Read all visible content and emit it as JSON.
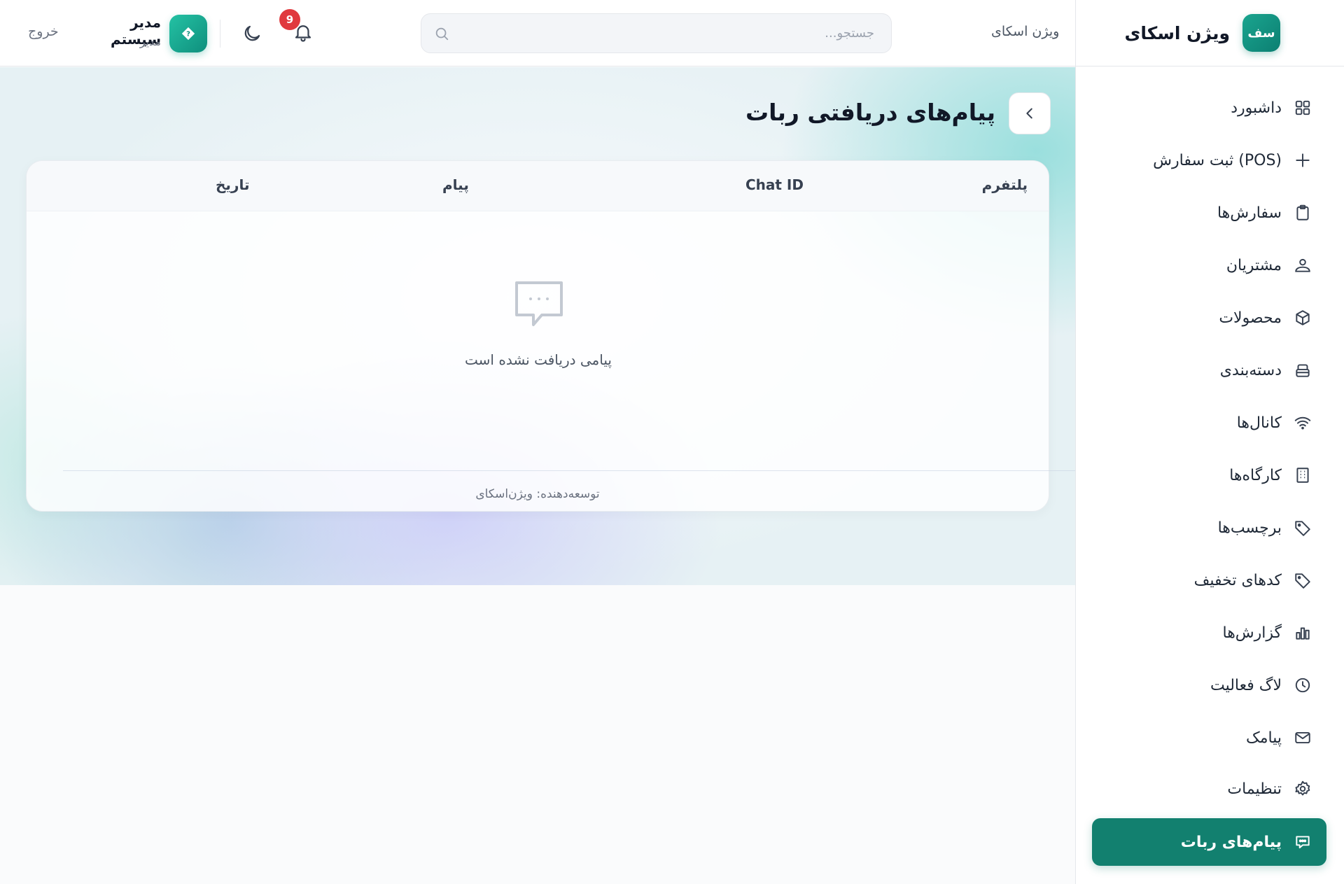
{
  "brand": {
    "logo_text": "سف",
    "name": "ویژن اسکای"
  },
  "header": {
    "brand_text": "ویژن اسکای",
    "search_placeholder": "جستجو...",
    "notifications_count": "9",
    "user_name": "مدیر سیستم",
    "user_role": "مدیر",
    "logout_label": "خروج"
  },
  "sidebar": {
    "items": [
      {
        "label": "داشبورد",
        "icon": "dashboard-icon"
      },
      {
        "label": "ثبت سفارش (POS)",
        "icon": "plus-icon"
      },
      {
        "label": "سفارش‌ها",
        "icon": "clipboard-icon"
      },
      {
        "label": "مشتریان",
        "icon": "customers-icon"
      },
      {
        "label": "محصولات",
        "icon": "box-icon"
      },
      {
        "label": "دسته‌بندی",
        "icon": "category-icon"
      },
      {
        "label": "کانال‌ها",
        "icon": "wifi-icon"
      },
      {
        "label": "کارگاه‌ها",
        "icon": "building-icon"
      },
      {
        "label": "برچسب‌ها",
        "icon": "tag-icon"
      },
      {
        "label": "کدهای تخفیف",
        "icon": "discount-tag-icon"
      },
      {
        "label": "گزارش‌ها",
        "icon": "bar-chart-icon"
      },
      {
        "label": "لاگ فعالیت",
        "icon": "clock-icon"
      },
      {
        "label": "پیامک",
        "icon": "mail-icon"
      },
      {
        "label": "تنظیمات",
        "icon": "gear-icon"
      },
      {
        "label": "پیام‌های ربات",
        "icon": "chat-icon",
        "active": true
      }
    ]
  },
  "main": {
    "title": "پیام‌های دریافتی ربات",
    "table": {
      "columns": [
        "پلتفرم",
        "Chat ID",
        "پیام",
        "تاریخ"
      ]
    },
    "empty_text": "پیامی دریافت نشده است",
    "footer": "توسعه‌دهنده: ویژن‌اسکای"
  },
  "colors": {
    "accent": "#12806f",
    "badge": "#e0393e"
  }
}
